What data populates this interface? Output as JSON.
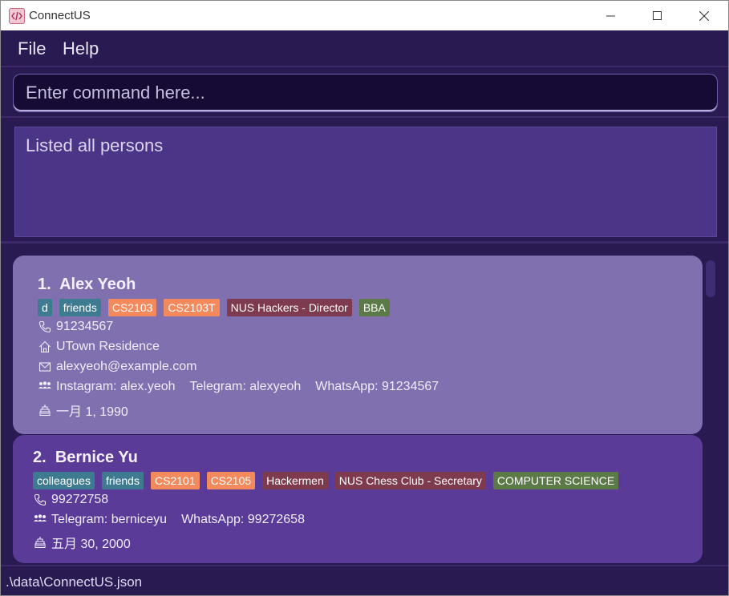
{
  "window": {
    "title": "ConnectUS"
  },
  "menu": {
    "items": [
      "File",
      "Help"
    ]
  },
  "command": {
    "placeholder": "Enter command here..."
  },
  "result": {
    "text": "Listed all persons"
  },
  "persons": [
    {
      "index": "1.",
      "name": "Alex Yeoh",
      "tags": [
        {
          "label": "d",
          "color": "#3e7b91"
        },
        {
          "label": "friends",
          "color": "#3e7b91"
        },
        {
          "label": "CS2103",
          "color": "#f38a5e"
        },
        {
          "label": "CS2103T",
          "color": "#f38a5e"
        },
        {
          "label": "NUS Hackers - Director",
          "color": "#7e3a4e"
        },
        {
          "label": "BBA",
          "color": "#5b7a47"
        }
      ],
      "phone": "91234567",
      "address": "UTown Residence",
      "email": "alexyeoh@example.com",
      "socials": [
        "Instagram: alex.yeoh",
        "Telegram: alexyeoh",
        "WhatsApp: 91234567"
      ],
      "birthday": "一月 1, 1990"
    },
    {
      "index": "2.",
      "name": "Bernice Yu",
      "tags": [
        {
          "label": "colleagues",
          "color": "#3e7b91"
        },
        {
          "label": "friends",
          "color": "#3e7b91"
        },
        {
          "label": "CS2101",
          "color": "#f38a5e"
        },
        {
          "label": "CS2105",
          "color": "#f38a5e"
        },
        {
          "label": "Hackermen",
          "color": "#7e3a4e"
        },
        {
          "label": "NUS Chess Club - Secretary",
          "color": "#7e3a4e"
        },
        {
          "label": "COMPUTER SCIENCE",
          "color": "#5b7a47"
        }
      ],
      "phone": "99272758",
      "socials": [
        "Telegram: berniceyu",
        "WhatsApp: 99272658"
      ],
      "birthday": "五月 30, 2000"
    }
  ],
  "status": {
    "path": ".\\data\\ConnectUS.json"
  },
  "icons": [
    "app-icon",
    "minimize-icon",
    "maximize-icon",
    "close-icon",
    "phone-icon",
    "home-icon",
    "mail-icon",
    "people-icon",
    "cake-icon"
  ]
}
